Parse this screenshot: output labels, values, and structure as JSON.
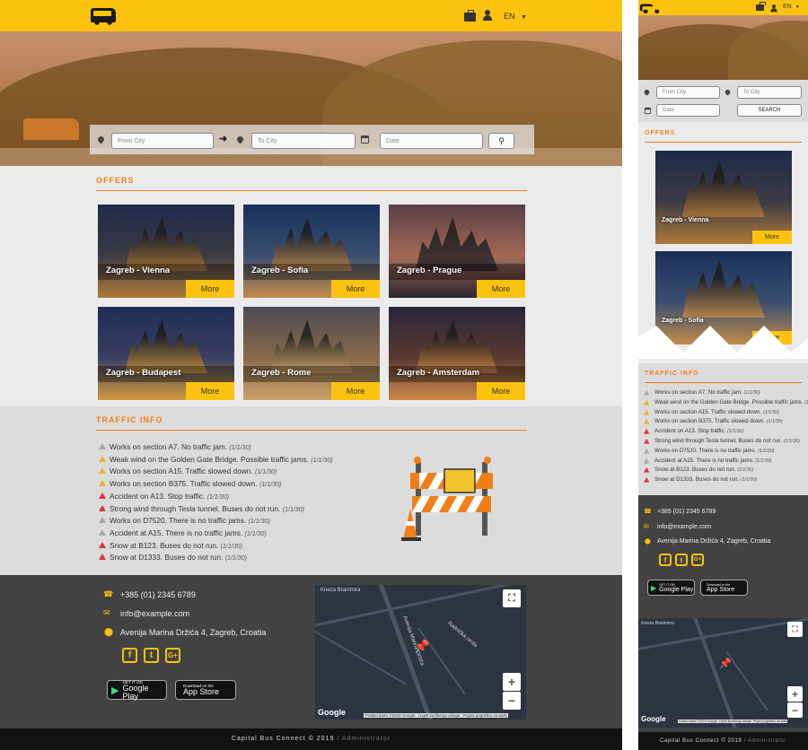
{
  "brand": {
    "accent": "#fbc310",
    "orange": "#f07f1a",
    "logo_icon": "bus-icon"
  },
  "header": {
    "language": "EN",
    "icons": [
      "briefcase-icon",
      "user-icon",
      "chevron-down-icon"
    ]
  },
  "search": {
    "from_placeholder": "From City",
    "to_placeholder": "To City",
    "date_placeholder": "Date",
    "search_label": "SEARCH",
    "search_icon": "search-icon"
  },
  "offers": {
    "title": "OFFERS",
    "more_label": "More",
    "items": [
      {
        "label": "Zagreb - Vienna",
        "colors": [
          "#1c2a48",
          "#3d3a45",
          "#b07a3a"
        ]
      },
      {
        "label": "Zagreb - Sofia",
        "colors": [
          "#17305a",
          "#3a4e70",
          "#c48b4a"
        ]
      },
      {
        "label": "Zagreb - Prague",
        "colors": [
          "#5a3e46",
          "#a26a55",
          "#2c2630"
        ]
      },
      {
        "label": "Zagreb - Budapest",
        "colors": [
          "#1f2d55",
          "#3b3f62",
          "#d39a3c"
        ]
      },
      {
        "label": "Zagreb - Rome",
        "colors": [
          "#4a4a52",
          "#8a6a4a",
          "#caa36a"
        ]
      },
      {
        "label": "Zagreb - Amsterdam",
        "colors": [
          "#28243a",
          "#5a3a30",
          "#d08a4a"
        ]
      }
    ]
  },
  "traffic": {
    "title": "TRAFFIC INFO",
    "items": [
      {
        "text": "Works on section A7. No traffic jam.",
        "date": "(1/1/30)",
        "level": "info",
        "color": "#aaaaaa"
      },
      {
        "text": "Weak wind on the Golden Gate Bridge. Possible traffic jams.",
        "date": "(1/1/30)",
        "level": "warning",
        "color": "#f0b030"
      },
      {
        "text": "Works on section A15. Traffic slowed down.",
        "date": "(1/1/30)",
        "level": "warning",
        "color": "#f0b030"
      },
      {
        "text": "Works on section B375. Traffic slowed down.",
        "date": "(1/1/30)",
        "level": "warning",
        "color": "#f0b030"
      },
      {
        "text": "Accident on A13. Stop traffic.",
        "date": "(1/1/30)",
        "level": "danger",
        "color": "#d9363e"
      },
      {
        "text": "Strong wind through Tesla tunnel. Buses do not run.",
        "date": "(1/1/30)",
        "level": "danger",
        "color": "#d9363e"
      },
      {
        "text": "Works on D7520. There is no traffic jams.",
        "date": "(1/1/30)",
        "level": "info",
        "color": "#aaaaaa"
      },
      {
        "text": "Accident at A15. There is no traffic jams.",
        "date": "(1/1/30)",
        "level": "info",
        "color": "#aaaaaa"
      },
      {
        "text": "Snow at B123. Buses do not run.",
        "date": "(1/1/30)",
        "level": "danger",
        "color": "#d9363e"
      },
      {
        "text": "Snow at D1333. Buses do not run.",
        "date": "(1/1/30)",
        "level": "danger",
        "color": "#d9363e"
      }
    ]
  },
  "contact": {
    "phone": "+385 (01) 2345 6789",
    "email": "info@example.com",
    "address": "Avenija Marina Držića 4, Zagreb, Croatia",
    "social": [
      "f",
      "t",
      "G+"
    ],
    "google_play": {
      "small": "GET IT ON",
      "big": "Google Play"
    },
    "app_store": {
      "small": "Download on the",
      "big": "App Store"
    }
  },
  "map": {
    "streets": [
      "Kneza Branimira",
      "Avenija Marina Držića",
      "Radnička cesta"
    ],
    "google": "Google",
    "attribution": [
      "Podaci karte ©2019 Google",
      "Uvjeti korištenja usluge",
      "Prijavi pogrešku na karti"
    ],
    "zoom_in": "+",
    "zoom_out": "−"
  },
  "footer": {
    "copyright": "Capital Bus Connect © 2019",
    "admin": "Administrator",
    "separator": "/"
  }
}
